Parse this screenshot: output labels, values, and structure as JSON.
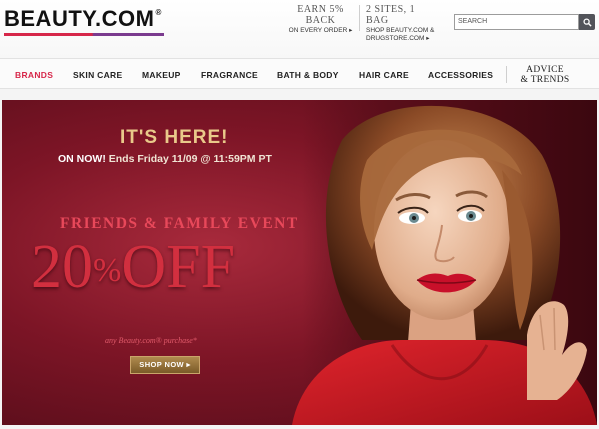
{
  "header": {
    "logo": "BEAUTY.COM",
    "logo_mark": "®",
    "promo1": {
      "title": "EARN 5% BACK",
      "subtitle": "ON EVERY ORDER ▸"
    },
    "promo2": {
      "title": "2 SITES, 1 BAG",
      "line1": "SHOP BEAUTY.COM &",
      "line2": "DRUGSTORE.COM ▸"
    },
    "search": {
      "placeholder": "SEARCH",
      "icon": "search-icon"
    }
  },
  "nav": {
    "items": [
      "BRANDS",
      "SKIN CARE",
      "MAKEUP",
      "FRAGRANCE",
      "BATH & BODY",
      "HAIR CARE",
      "ACCESSORIES"
    ],
    "advice_line1": "ADVICE",
    "advice_line2": "& TRENDS",
    "active_color": "#d7274a"
  },
  "hero": {
    "headline": "IT'S HERE!",
    "on_now": "ON NOW!",
    "ends": " Ends Friday 11/09 @ 11:59PM PT",
    "event": "FRIENDS & FAMILY EVENT",
    "discount_num": "20",
    "discount_pct": "%",
    "discount_off": "OFF",
    "fine_print": "any Beauty.com® purchase*",
    "cta": "SHOP NOW ▸",
    "accent_color": "#d22f3f",
    "gold_color": "#e9c98a"
  }
}
